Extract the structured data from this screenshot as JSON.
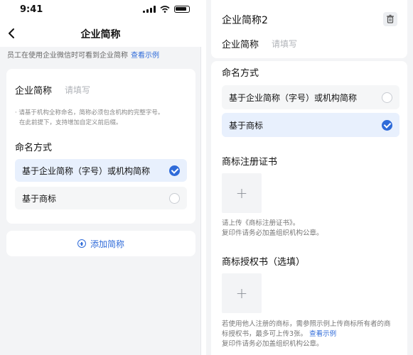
{
  "left": {
    "status_time": "9:41",
    "nav_title": "企业简称",
    "hint_text": "员工在使用企业微信时可看到企业简称",
    "hint_link": "查看示例",
    "name_label": "企业简称",
    "name_placeholder": "请填写",
    "note_line1": "· 请基于机构全称命名，简称必须包含机构的完整字号。",
    "note_line2": "在此前提下，支持增加自定义前后缀。",
    "naming_label": "命名方式",
    "option1": "基于企业简称（字号）或机构简称",
    "option2": "基于商标",
    "add_label": "添加简称"
  },
  "right": {
    "title": "企业简称2",
    "name_label": "企业简称",
    "name_placeholder": "请填写",
    "naming_label": "命名方式",
    "option1": "基于企业简称（字号）或机构简称",
    "option2": "基于商标",
    "cert_label": "商标注册证书",
    "cert_note1": "请上传《商标注册证书》。",
    "cert_note2": "复印件请务必加盖组织机构公章。",
    "auth_label": "商标授权书（选填）",
    "auth_note1": "若使用他人注册的商标，需参照示例上传商标所有者的商",
    "auth_note2": "标授权书，最多可上传3张。",
    "auth_link": "查看示例",
    "auth_note3": "复印件请务必加盖组织机构公章。",
    "upload_symbol": "+"
  },
  "colors": {
    "accent": "#2f6bd9",
    "selected_bg": "#e8f0fd",
    "page_bg": "#f3f4f6"
  }
}
